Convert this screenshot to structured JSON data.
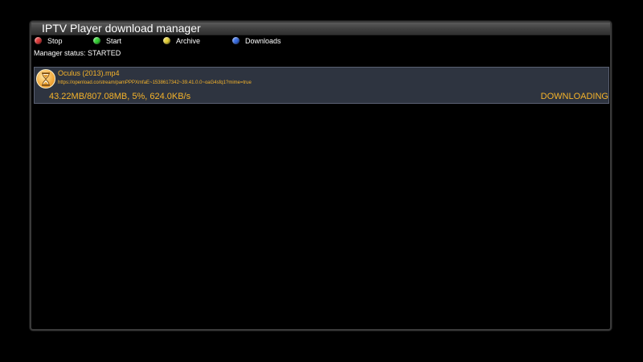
{
  "window": {
    "title": "IPTV Player download manager"
  },
  "keys": [
    {
      "label": "Stop",
      "color": "#e03a3a"
    },
    {
      "label": "Start",
      "color": "#35d435"
    },
    {
      "label": "Archive",
      "color": "#e6d23a"
    },
    {
      "label": "Downloads",
      "color": "#3a6fe6"
    }
  ],
  "status": {
    "text": "Manager status: STARTED"
  },
  "downloads": [
    {
      "icon": "hourglass-icon",
      "name": "Oculus (2013).mp4",
      "url": "https://openload.co/stream/pamPPPXmfaE~1538617342~39.41.0.0~oaG4sfq1?mime=true",
      "progress": "43.22MB/807.08MB, 5%, 624.0KB/s",
      "state": "DOWNLOADING"
    }
  ],
  "colors": {
    "accent_text": "#f5b32a",
    "row_background": "#2e3440"
  }
}
